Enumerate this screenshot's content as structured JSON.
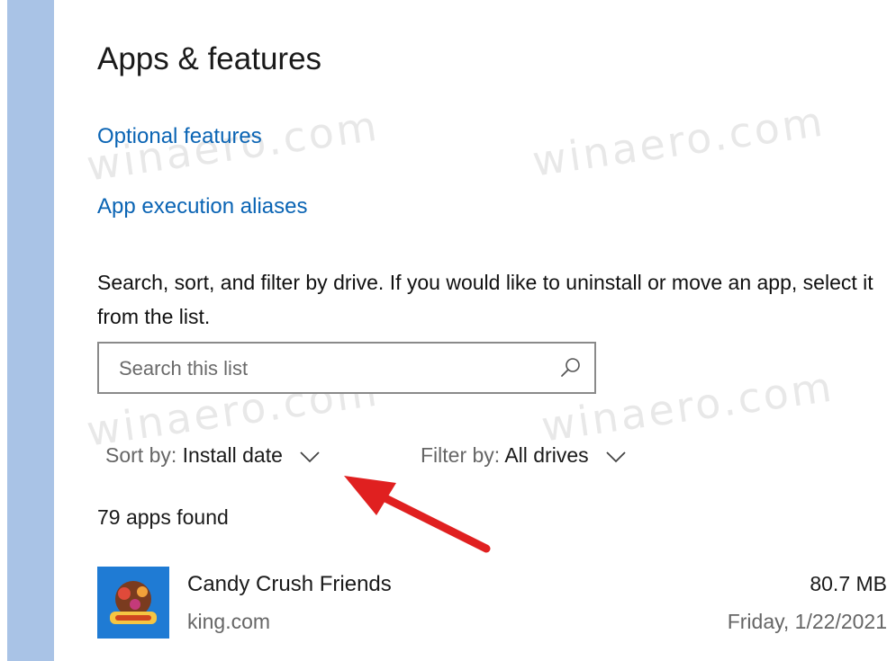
{
  "page": {
    "title": "Apps & features",
    "links": {
      "optional_features": "Optional features",
      "app_execution_aliases": "App execution aliases"
    },
    "description": "Search, sort, and filter by drive. If you would like to uninstall or move an app, select it from the list.",
    "search": {
      "placeholder": "Search this list",
      "icon": "search-icon"
    },
    "sort": {
      "label": "Sort by:",
      "value": "Install date"
    },
    "filter": {
      "label": "Filter by:",
      "value": "All drives"
    },
    "apps_count": "79 apps found",
    "apps": [
      {
        "name": "Candy Crush Friends",
        "publisher": "king.com",
        "size": "80.7 MB",
        "date": "Friday, 1/22/2021",
        "icon": "candy-crush-friends-icon"
      }
    ]
  },
  "watermark": "winaero.com",
  "colors": {
    "link": "#0a64b4",
    "sidebar": "#a9c3e6",
    "annotation_arrow": "#e02020"
  },
  "annotation": {
    "type": "red-arrow",
    "points_to": "sort-dropdown"
  }
}
